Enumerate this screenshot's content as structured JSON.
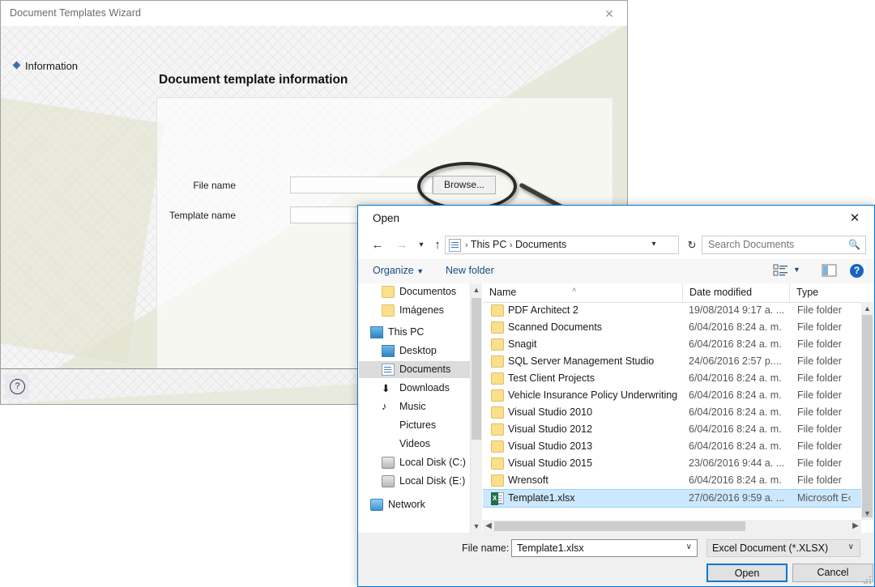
{
  "wizard": {
    "title": "Document Templates Wizard",
    "close_icon": "close-icon",
    "step_label": "Information",
    "heading": "Document template information",
    "fields": [
      {
        "label": "File name",
        "value": ""
      },
      {
        "label": "Template name",
        "value": ""
      }
    ],
    "browse_label": "Browse...",
    "help_glyph": "?"
  },
  "dialog": {
    "title": "Open",
    "close_icon": "close-icon",
    "nav": {
      "back_icon": "back-arrow-icon",
      "forward_icon": "forward-arrow-icon",
      "recent_icon": "chevron-down-icon",
      "up_icon": "up-arrow-icon"
    },
    "breadcrumb": {
      "icon": "documents-icon",
      "sep": "›",
      "parts": [
        "This PC",
        "Documents"
      ],
      "dropdown_icon": "chevron-down-icon",
      "refresh_icon": "refresh-icon"
    },
    "search": {
      "placeholder": "Search Documents",
      "icon": "search-icon"
    },
    "toolbar": {
      "organize": "Organize",
      "organize_caret": "▼",
      "new_folder": "New folder",
      "view_icon": "view-options-icon",
      "view_caret": "▼",
      "preview_icon": "preview-pane-icon",
      "help_icon": "help-icon",
      "help_glyph": "?"
    },
    "nav_tree": [
      {
        "label": "Documentos",
        "icon": "folder-icon",
        "indent": 28,
        "selected": false
      },
      {
        "label": "Imágenes",
        "icon": "folder-icon",
        "indent": 28,
        "selected": false
      },
      {
        "label": "This PC",
        "icon": "computer-icon",
        "indent": 14,
        "selected": false
      },
      {
        "label": "Desktop",
        "icon": "desktop-icon",
        "indent": 28,
        "selected": false
      },
      {
        "label": "Documents",
        "icon": "documents-icon",
        "indent": 28,
        "selected": true
      },
      {
        "label": "Downloads",
        "icon": "downloads-icon",
        "indent": 28,
        "selected": false
      },
      {
        "label": "Music",
        "icon": "music-icon",
        "indent": 28,
        "selected": false
      },
      {
        "label": "Pictures",
        "icon": "pictures-icon",
        "indent": 28,
        "selected": false
      },
      {
        "label": "Videos",
        "icon": "videos-icon",
        "indent": 28,
        "selected": false
      },
      {
        "label": "Local Disk (C:)",
        "icon": "disk-icon",
        "indent": 28,
        "selected": false
      },
      {
        "label": "Local Disk (E:)",
        "icon": "disk-icon",
        "indent": 28,
        "selected": false
      },
      {
        "label": "Network",
        "icon": "network-icon",
        "indent": 14,
        "selected": false
      }
    ],
    "columns": [
      {
        "label": "Name",
        "sorted": true,
        "sort_glyph": "˄"
      },
      {
        "label": "Date modified",
        "sorted": false
      },
      {
        "label": "Type",
        "sorted": false
      }
    ],
    "files": [
      {
        "name": "PDF Architect 2",
        "date": "19/08/2014 9:17 a. ...",
        "type": "File folder",
        "icon": "folder-icon",
        "selected": false
      },
      {
        "name": "Scanned Documents",
        "date": "6/04/2016 8:24 a. m.",
        "type": "File folder",
        "icon": "folder-icon",
        "selected": false
      },
      {
        "name": "Snagit",
        "date": "6/04/2016 8:24 a. m.",
        "type": "File folder",
        "icon": "folder-icon",
        "selected": false
      },
      {
        "name": "SQL Server Management Studio",
        "date": "24/06/2016 2:57 p....",
        "type": "File folder",
        "icon": "folder-icon",
        "selected": false
      },
      {
        "name": "Test Client Projects",
        "date": "6/04/2016 8:24 a. m.",
        "type": "File folder",
        "icon": "folder-icon",
        "selected": false
      },
      {
        "name": "Vehicle Insurance Policy Underwriting",
        "date": "6/04/2016 8:24 a. m.",
        "type": "File folder",
        "icon": "folder-icon",
        "selected": false
      },
      {
        "name": "Visual Studio 2010",
        "date": "6/04/2016 8:24 a. m.",
        "type": "File folder",
        "icon": "folder-icon",
        "selected": false
      },
      {
        "name": "Visual Studio 2012",
        "date": "6/04/2016 8:24 a. m.",
        "type": "File folder",
        "icon": "folder-icon",
        "selected": false
      },
      {
        "name": "Visual Studio 2013",
        "date": "6/04/2016 8:24 a. m.",
        "type": "File folder",
        "icon": "folder-icon",
        "selected": false
      },
      {
        "name": "Visual Studio 2015",
        "date": "23/06/2016 9:44 a. ...",
        "type": "File folder",
        "icon": "folder-icon",
        "selected": false
      },
      {
        "name": "Wrensoft",
        "date": "6/04/2016 8:24 a. m.",
        "type": "File folder",
        "icon": "folder-icon",
        "selected": false
      },
      {
        "name": "Template1.xlsx",
        "date": "27/06/2016 9:59 a. ...",
        "type": "Microsoft E‹",
        "icon": "excel-icon",
        "selected": true
      }
    ],
    "bottom": {
      "file_name_label": "File name:",
      "file_name_value": "Template1.xlsx",
      "file_name_caret": "∨",
      "filter_value": "Excel Document (*.XLSX)",
      "filter_caret": "∨",
      "open_label": "Open",
      "cancel_label": "Cancel"
    }
  },
  "annotation": {
    "ellipse": "highlight-ellipse",
    "arrow": "pointer-arrow",
    "color": "#2b2b2b"
  }
}
